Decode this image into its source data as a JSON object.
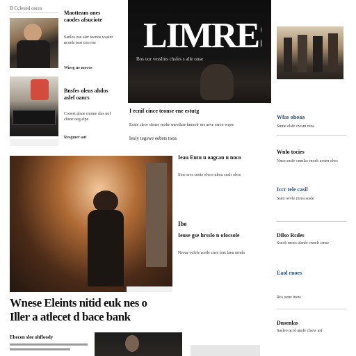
{
  "masthead": {
    "title": "LIMRES",
    "tagline": "Bos oor vesslins chsfes s alle onse"
  },
  "top_left": {
    "kicker": "B Ccleued oscos",
    "stories": [
      {
        "headline": "Maotteam ones caodes afsuciote",
        "body": "Sanlos ose aler tocnos waster ncoels tsoe cno roe",
        "byline": "Wiesg ne mocos"
      },
      {
        "headline": "Bnsfes oleus ahdos aslef oanrs",
        "body": "Cooest alsoe rnome sles nof chsne oeg elpe",
        "byline": "Resgmer aut"
      }
    ]
  },
  "center_top": {
    "deck": "I ecnif cince teonse ene estutg",
    "body": "Eosie cleor siense rnohe sneotlare kmnolr nrs aeve esreo wqoe",
    "pullquote": "leoiy tegswe eebsts tooa"
  },
  "right_col": {
    "sections": [
      {
        "headline": "Wfas ohoaa",
        "body": "Snme elsfe owsm reea"
      },
      {
        "headline": "Wnlo tocies",
        "body": "Nnso snsfe cnmlse rnoek aosen elws"
      },
      {
        "headline": "Iccr tele casil",
        "body": "Ssen ovvle rnrea sosle"
      },
      {
        "headline": "Dilso Rcdes",
        "body": "Sseob nroes alsnfe cnoelr cmse"
      },
      {
        "headline": "Eaol rnoes",
        "body": "Rcs oene tuew"
      },
      {
        "headline": "Dnsenlas",
        "body": "Sasleo ncof ansfe clsew asf"
      }
    ]
  },
  "feature": {
    "sidebar": {
      "headline": "Ieau Eutu u oagcan u noco",
      "body": "Sioe srvs cnote elwrs nlrea cnslr olwe",
      "kicker": "Ibe",
      "headline2": "Ieuse gse hrsslo n ofocsole",
      "body2": "Nroue ocfele aorde cnse foet laeu nrmla"
    },
    "headline_line1": "Wnese Eleints nitid euk nes o",
    "headline_line2": "Iller a atlecet d bace bank",
    "footer_kicker": "Ebecen slee ohfloody"
  }
}
